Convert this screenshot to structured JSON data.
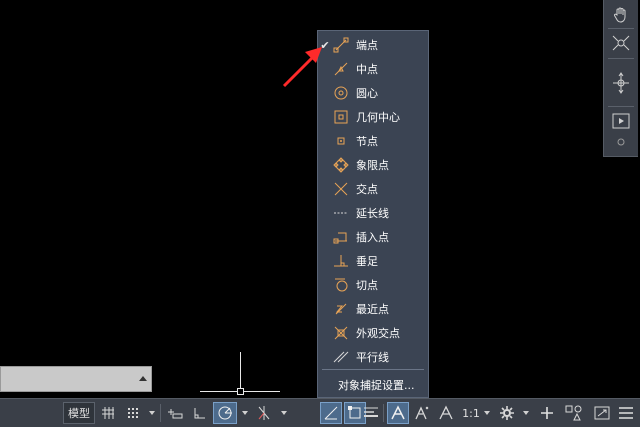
{
  "menu": {
    "items": [
      {
        "label": "端点",
        "checked": true,
        "icon": "endpoint-icon"
      },
      {
        "label": "中点",
        "checked": false,
        "icon": "midpoint-icon"
      },
      {
        "label": "圆心",
        "checked": false,
        "icon": "center-icon"
      },
      {
        "label": "几何中心",
        "checked": false,
        "icon": "geometric-center-icon"
      },
      {
        "label": "节点",
        "checked": false,
        "icon": "node-icon"
      },
      {
        "label": "象限点",
        "checked": false,
        "icon": "quadrant-icon"
      },
      {
        "label": "交点",
        "checked": false,
        "icon": "intersection-icon"
      },
      {
        "label": "延长线",
        "checked": false,
        "icon": "extension-icon"
      },
      {
        "label": "插入点",
        "checked": false,
        "icon": "insertion-icon"
      },
      {
        "label": "垂足",
        "checked": false,
        "icon": "perpendicular-icon"
      },
      {
        "label": "切点",
        "checked": false,
        "icon": "tangent-icon"
      },
      {
        "label": "最近点",
        "checked": false,
        "icon": "nearest-icon"
      },
      {
        "label": "外观交点",
        "checked": false,
        "icon": "apparent-intersection-icon"
      },
      {
        "label": "平行线",
        "checked": false,
        "icon": "parallel-icon"
      }
    ],
    "settings_label": "对象捕捉设置...",
    "check_mark": "✔"
  },
  "statusbar": {
    "model_label": "模型",
    "scale_label": "1:1"
  },
  "colors": {
    "accent": "#4d6b8c",
    "snap_icon": "#e8a456",
    "annotation_arrow": "#ff2a2a"
  }
}
